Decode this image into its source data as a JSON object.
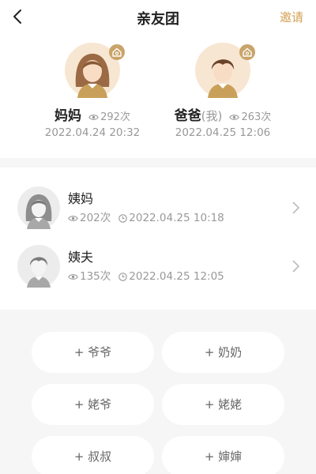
{
  "header": {
    "title": "亲友团",
    "invite_label": "邀请"
  },
  "primary_members": [
    {
      "name": "妈妈",
      "me_tag": "",
      "views": "292次",
      "datetime": "2022.04.24 20:32"
    },
    {
      "name": "爸爸",
      "me_tag": "(我)",
      "views": "263次",
      "datetime": "2022.04.25 12:06"
    }
  ],
  "relatives": [
    {
      "name": "姨妈",
      "views": "202次",
      "datetime": "2022.04.25 10:18"
    },
    {
      "name": "姨夫",
      "views": "135次",
      "datetime": "2022.04.25 12:05"
    }
  ],
  "add_buttons": [
    "+ 爷爷",
    "+ 奶奶",
    "+ 姥爷",
    "+ 姥姥",
    "+ 叔叔",
    "+ 婶婶"
  ],
  "colors": {
    "accent": "#d4a055",
    "badge": "#c9a46a",
    "background": "#f6f6f6"
  }
}
